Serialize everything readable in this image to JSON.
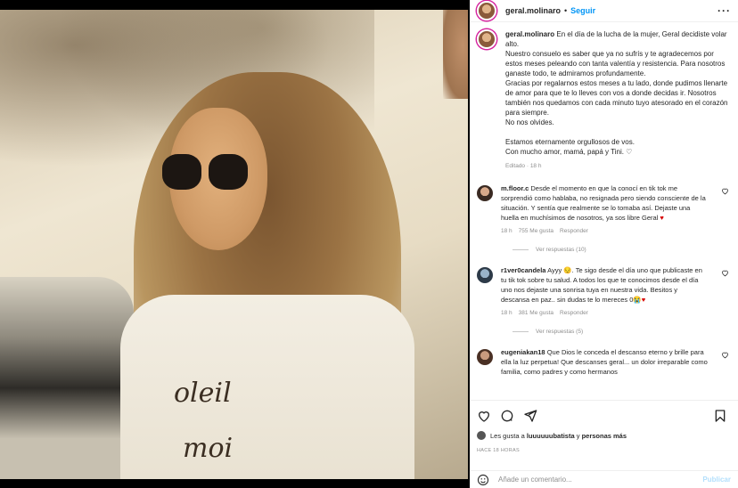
{
  "post": {
    "image_alt": "Foto de Geral sonriendo con lentes de sol y remera blanca",
    "shirt_text_line1": "oleil",
    "shirt_text_line2": "moi"
  },
  "header": {
    "username": "geral.molinaro",
    "dot": "•",
    "follow_label": "Seguir",
    "more_label": "···"
  },
  "caption": {
    "username": "geral.molinaro",
    "text": "En el día de la lucha de la mujer, Geral decidiste volar alto.\nNuestro consuelo es saber que ya no sufrís y te agradecemos por estos meses peleando con tanta valentía y resistencia. Para nosotros ganaste todo, te admiramos profundamente.\nGracias por regalarnos estos meses a tu lado, donde pudimos llenarte de amor para que te lo lleves con vos a donde decidas ir. Nosotros también nos quedamos con cada minuto tuyo atesorado en el corazón para siempre.\nNo nos olvides.\n\nEstamos eternamente orgullosos de vos.\nCon mucho amor, mamá, papá y Tini. ♡",
    "meta": "Editado · 18 h"
  },
  "comments": [
    {
      "username": "m.floor.c",
      "text": "Desde el momento en que la conocí en tik tok me sorprendió como hablaba, no resignada pero siendo consciente de la situación. Y sentía que realmente se lo tomaba así. Dejaste una huella en muchísimos de nosotros, ya sos libre Geral ",
      "emoji": "♥",
      "time": "18 h",
      "likes": "755 Me gusta",
      "reply": "Responder",
      "view_replies": "Ver respuestas (10)"
    },
    {
      "username": "r1ver0candela",
      "text": "Ayyy 😔. Te sigo desde el día uno que publicaste en tu tik tok sobre tu salud. A todos los que te conocimos desde el día uno nos dejaste una sonrisa tuya en nuestra vida. Besitos y descansa en paz.. sin dudas te lo mereces 0",
      "emoji": "😭♥",
      "time": "18 h",
      "likes": "381 Me gusta",
      "reply": "Responder",
      "view_replies": "Ver respuestas (5)"
    },
    {
      "username": "eugeniakan18",
      "text": "Que Dios le conceda el descanso eterno y brille para ella la luz perpetua! Que descanses geral... un dolor irreparable como familia, como padres y como hermanos"
    }
  ],
  "actions": {
    "liked_by_prefix": "Les gusta a",
    "liked_by_user": "luuuuuubatista",
    "liked_by_and": "y",
    "liked_by_others": "personas más",
    "time_ago": "HACE 18 HORAS"
  },
  "add_comment": {
    "placeholder": "Añade un comentario...",
    "post_label": "Publicar"
  },
  "colors": {
    "accent": "#0095f6",
    "muted": "#8e8e8e",
    "heart_red": "#d60000"
  }
}
